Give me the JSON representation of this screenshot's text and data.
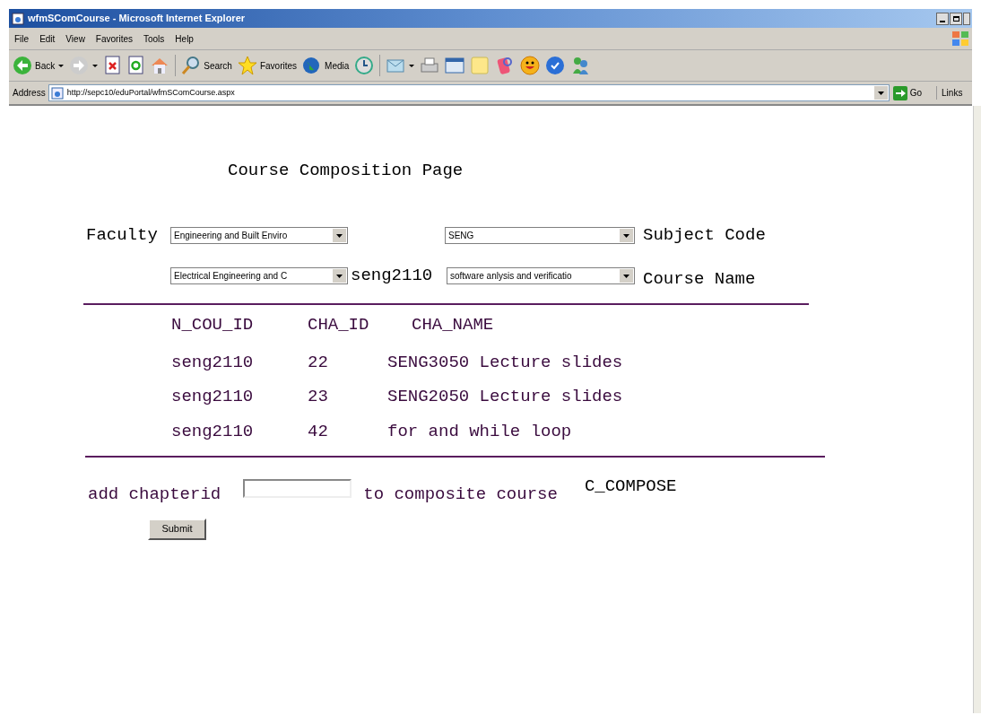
{
  "window": {
    "title": "wfmSComCourse - Microsoft Internet Explorer"
  },
  "menu": [
    "File",
    "Edit",
    "View",
    "Favorites",
    "Tools",
    "Help"
  ],
  "toolbar": [
    {
      "kind": "back",
      "label": "Back"
    },
    {
      "kind": "forward"
    },
    {
      "kind": "stop"
    },
    {
      "kind": "refresh"
    },
    {
      "kind": "home"
    },
    {
      "kind": "search",
      "label": "Search"
    },
    {
      "kind": "favorites",
      "label": "Favorites"
    },
    {
      "kind": "media",
      "label": "Media"
    },
    {
      "kind": "history"
    },
    {
      "kind": "mail"
    },
    {
      "kind": "print"
    },
    {
      "kind": "edit"
    },
    {
      "kind": "note"
    },
    {
      "kind": "discuss"
    },
    {
      "kind": "smiley"
    },
    {
      "kind": "globe"
    },
    {
      "kind": "messenger"
    }
  ],
  "address": {
    "label": "Address",
    "url": "http://sepc10/eduPortal/wfmSComCourse.aspx",
    "go": "Go",
    "links": "Links"
  },
  "page": {
    "title": "Course Composition Page",
    "faculty_label": "Faculty",
    "faculty_select": "Engineering and Built Enviro",
    "subject_select": "SENG",
    "subject_label": "Subject Code",
    "school_select": "Electrical Engineering and C",
    "course_id": "seng2110",
    "course_select": "software anlysis and verificatio",
    "course_label": "Course Name",
    "table": {
      "columns": [
        "N_COU_ID",
        "CHA_ID",
        "CHA_NAME"
      ],
      "rows": [
        [
          "seng2110",
          "22",
          "SENG3050 Lecture slides"
        ],
        [
          "seng2110",
          "23",
          "SENG2050 Lecture slides"
        ],
        [
          "seng2110",
          "42",
          "for and while loop"
        ]
      ]
    },
    "add_label": "add chapterid",
    "add_suffix": "to composite course",
    "composite_name": "C_COMPOSE",
    "submit": "Submit"
  }
}
